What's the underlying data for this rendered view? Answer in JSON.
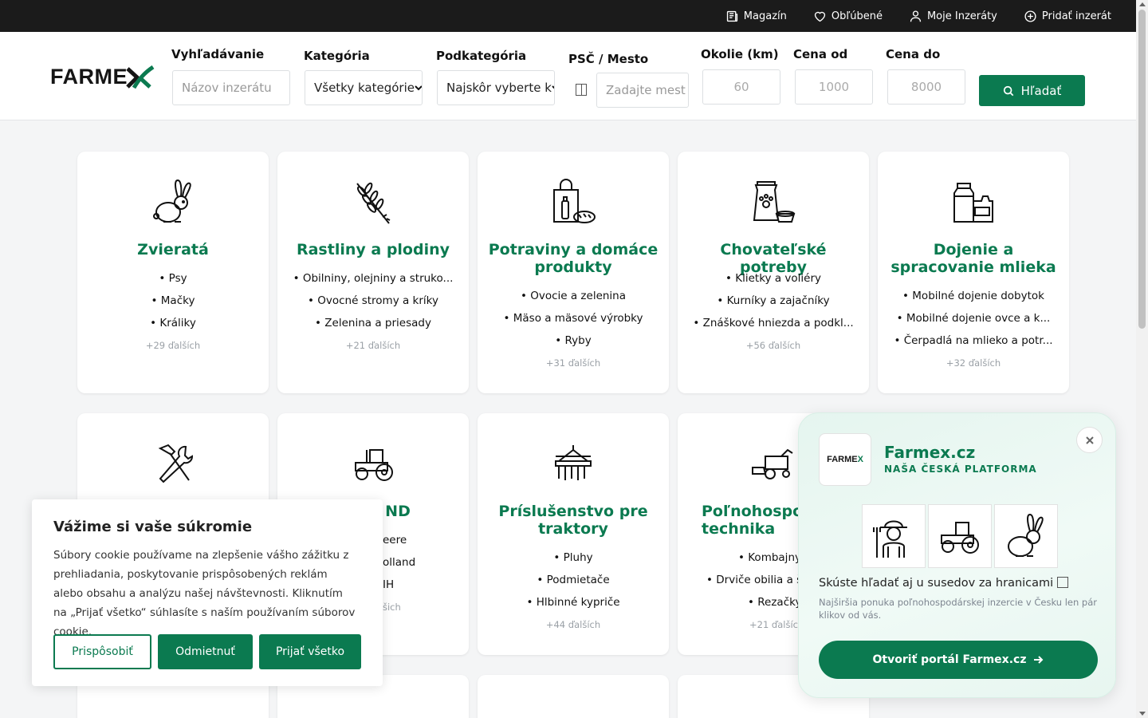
{
  "topbar": {
    "magazin": "Magazín",
    "favorites": "Obľúbené",
    "my_ads": "Moje Inzeráty",
    "add_ad": "Pridať inzerát"
  },
  "logo": {
    "text": "FARME"
  },
  "search": {
    "label_query": "Vyhľadávanie",
    "placeholder_query": "Názov inzerátu",
    "label_category": "Kategória",
    "value_category": "Všetky kategórie",
    "label_subcategory": "Podkategória",
    "value_subcategory": "Najskôr vyberte k",
    "label_location": "PSČ / Mesto",
    "placeholder_location": "Zadajte mest",
    "label_radius": "Okolie (km)",
    "placeholder_radius": "60",
    "label_price_from": "Cena od",
    "placeholder_price_from": "1000",
    "label_price_to": "Cena do",
    "placeholder_price_to": "8000",
    "button": "Hľadať"
  },
  "categories": [
    {
      "title": "Zvieratá",
      "items": [
        "• Psy",
        "• Mačky",
        "• Králiky"
      ],
      "more": "+29 ďalších",
      "icon": "rabbit-icon"
    },
    {
      "title": "Rastliny a plodiny",
      "items": [
        "• Obilniny, olejniny a struko...",
        "• Ovocné stromy a kríky",
        "• Zelenina a priesady"
      ],
      "more": "+21 ďalších",
      "icon": "wheat-icon"
    },
    {
      "title": "Potraviny a domáce produkty",
      "items": [
        "• Ovocie a zelenina",
        "• Mäso a mäsové výrobky",
        "• Ryby"
      ],
      "more": "+31 ďalších",
      "icon": "grocery-bag-icon"
    },
    {
      "title": "Chovateľské potreby",
      "items": [
        "• Klietky a voliéry",
        "• Kurníky a zajačníky",
        "• Znáškové hniezda a podkl..."
      ],
      "more": "+56 ďalších",
      "icon": "pet-food-icon"
    },
    {
      "title": "Dojenie a spracovanie mlieka",
      "items": [
        "• Mobilné dojenie dobytok",
        "• Mobilné dojenie ovce a k...",
        "• Čerpadlá na mlieko a potr..."
      ],
      "more": "+32 ďalších",
      "icon": "milk-can-icon"
    },
    {
      "title": "",
      "items": [],
      "more": "",
      "icon": "tools-icon"
    },
    {
      "title": "& ND",
      "items": [
        "eere",
        "olland",
        "IH"
      ],
      "more": "šich",
      "icon": "tractor-icon"
    },
    {
      "title": "Príslušenstvo pre traktory",
      "items": [
        "• Pluhy",
        "• Podmietače",
        "• Hlbinné kypriče"
      ],
      "more": "+44 ďalších",
      "icon": "cultivator-icon"
    },
    {
      "title": "Poľnohospod technika",
      "items": [
        "• Kombajny",
        "• Drviče obilia a šr",
        "• Rezačky"
      ],
      "more": "+21 ďalšíc",
      "icon": "harvester-icon"
    }
  ],
  "cookie": {
    "title": "Vážime si vaše súkromie",
    "text": "Súbory cookie používame na zlepšenie vášho zážitku z prehliadania, poskytovanie prispôsobených reklám alebo obsahu a analýzu našej návštevnosti. Kliknutím na „Prijať všetko“ súhlasíte s naším používaním súborov cookie.",
    "customize": "Prispôsobiť",
    "reject": "Odmietnuť",
    "accept": "Prijať všetko"
  },
  "promo": {
    "logo": "FARME",
    "name": "Farmex.cz",
    "subtitle": "NAŠA ČESKÁ PLATFORMA",
    "headline": "Skúste hľadať aj u susedov za hranicami",
    "description": "Najširšia ponuka poľnohospodárskej inzercie v Česku len pár klikov od vás.",
    "button": "Otvoriť portál Farmex.cz"
  },
  "colors": {
    "brand": "#0b7a50",
    "topbar": "#1b1b1b"
  }
}
